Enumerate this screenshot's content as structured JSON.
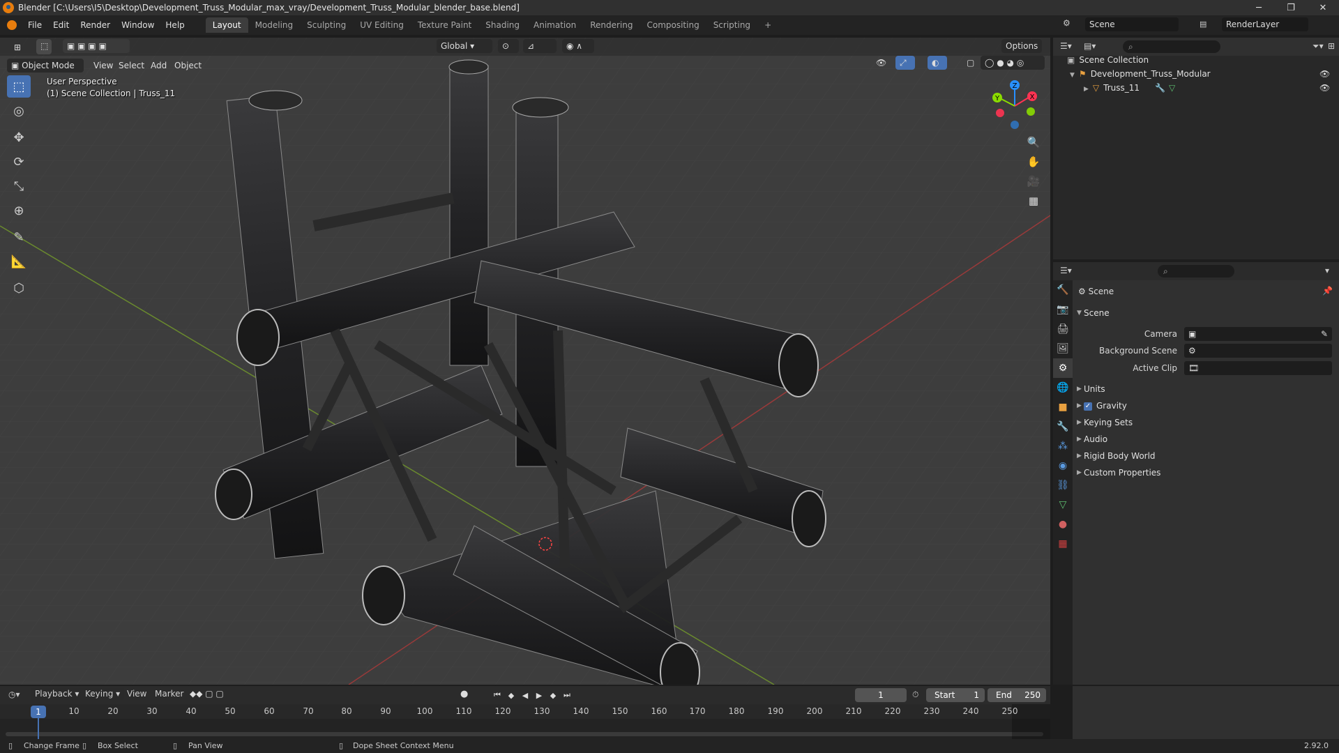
{
  "titlebar": {
    "title": "Blender [C:\\Users\\I5\\Desktop\\Development_Truss_Modular_max_vray/Development_Truss_Modular_blender_base.blend]",
    "minimize": "─",
    "maximize": "❐",
    "close": "✕"
  },
  "menu": [
    "File",
    "Edit",
    "Render",
    "Window",
    "Help"
  ],
  "workspaces": [
    "Layout",
    "Modeling",
    "Sculpting",
    "UV Editing",
    "Texture Paint",
    "Shading",
    "Animation",
    "Rendering",
    "Compositing",
    "Scripting",
    "+"
  ],
  "active_workspace": "Layout",
  "scene_selector": "Scene",
  "view_layer": "RenderLayer",
  "viewport": {
    "mode": "Object Mode",
    "menus": [
      "View",
      "Select",
      "Add",
      "Object"
    ],
    "orientation": "Global",
    "options": "Options",
    "overlay_line1": "User Perspective",
    "overlay_line2": "(1) Scene Collection | Truss_11",
    "gizmo": {
      "x": "X",
      "y": "Y",
      "z": "Z"
    },
    "colors": {
      "accent": "#4772b3",
      "x_axis": "#ff3352",
      "y_axis": "#8bdc00",
      "z_axis": "#2890ff"
    }
  },
  "tools": [
    "select-box-icon",
    "cursor-icon",
    "move-icon",
    "rotate-icon",
    "scale-icon",
    "transform-icon",
    "annotate-icon",
    "measure-icon",
    "add-cube-icon"
  ],
  "outliner": {
    "root": "Scene Collection",
    "collection": "Development_Truss_Modular",
    "object": "Truss_11"
  },
  "properties": {
    "header": "Scene",
    "panel": "Scene",
    "camera_label": "Camera",
    "background_scene_label": "Background Scene",
    "active_clip_label": "Active Clip",
    "sections": [
      "Units",
      "Gravity",
      "Keying Sets",
      "Audio",
      "Rigid Body World",
      "Custom Properties"
    ],
    "gravity_checked": true
  },
  "timeline": {
    "menus": [
      "Playback",
      "Keying",
      "View",
      "Marker"
    ],
    "current_frame": "1",
    "start_label": "Start",
    "start": "1",
    "end_label": "End",
    "end": "250",
    "ticks": [
      "10",
      "20",
      "30",
      "40",
      "50",
      "60",
      "70",
      "80",
      "90",
      "100",
      "110",
      "120",
      "130",
      "140",
      "150",
      "160",
      "170",
      "180",
      "190",
      "200",
      "210",
      "220",
      "230",
      "240",
      "250"
    ],
    "playhead": "1"
  },
  "status": {
    "change_frame": "Change Frame",
    "box_select": "Box Select",
    "pan_view": "Pan View",
    "context_menu": "Dope Sheet Context Menu",
    "version": "2.92.0"
  }
}
